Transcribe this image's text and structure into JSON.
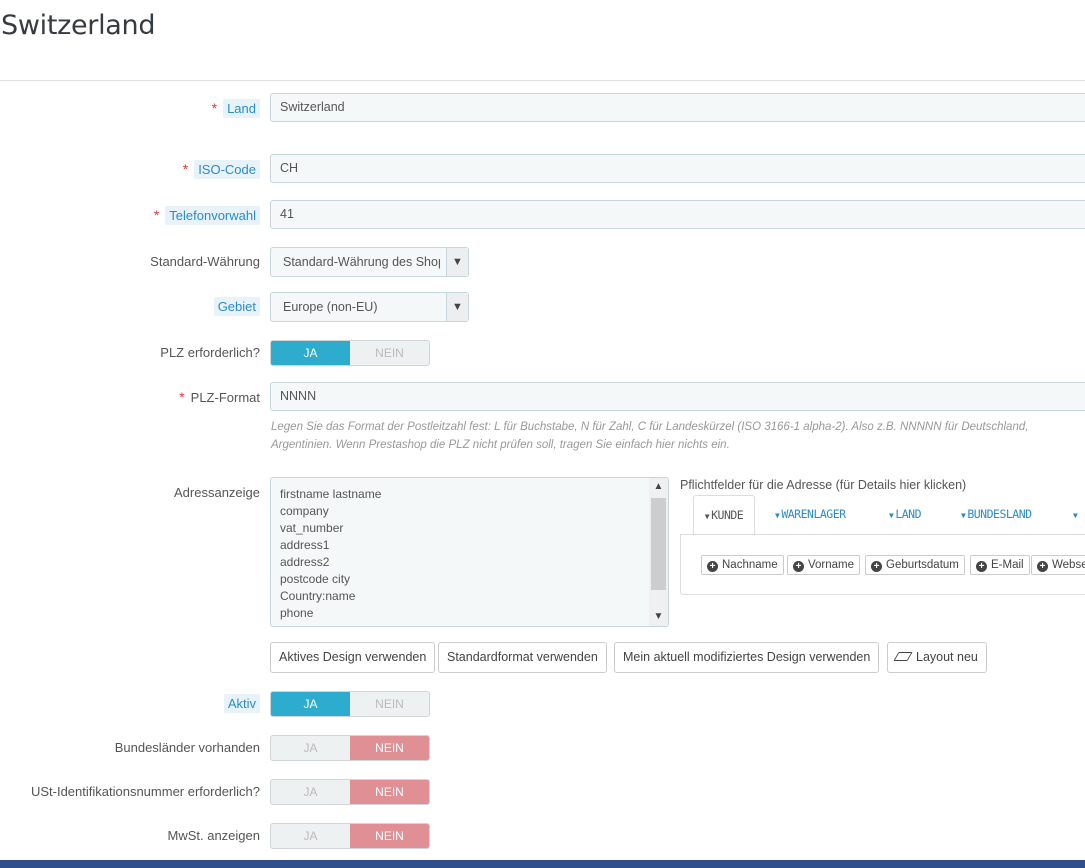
{
  "page": {
    "title": "Switzerland"
  },
  "form": {
    "land": {
      "label": "Land",
      "value": "Switzerland"
    },
    "iso": {
      "label": "ISO-Code",
      "value": "CH"
    },
    "phone": {
      "label": "Telefonvorwahl",
      "value": "41"
    },
    "currency": {
      "label": "Standard-Währung",
      "value": "Standard-Währung des Shop"
    },
    "zone": {
      "label": "Gebiet",
      "value": "Europe (non-EU)"
    },
    "zip_required": {
      "label": "PLZ erforderlich?",
      "yes": "JA",
      "no": "NEIN",
      "active": "yes"
    },
    "zip_format": {
      "label": "PLZ-Format",
      "value": "NNNN",
      "help_line1": "Legen Sie das Format der Postleitzahl fest: L für Buchstabe, N für Zahl, C für Landeskürzel (ISO 3166-1 alpha-2). Also z.B. NNNNN für Deutschland,",
      "help_line2": "Argentinien. Wenn Prestashop die PLZ nicht prüfen soll, tragen Sie einfach hier nichts ein."
    },
    "address_layout": {
      "label": "Adressanzeige",
      "lines": [
        "firstname lastname",
        "company",
        "vat_number",
        "address1",
        "address2",
        "postcode city",
        "Country:name",
        "phone"
      ]
    },
    "required_fields": {
      "title": "Pflichtfelder für die Adresse (für Details hier klicken)",
      "tabs": [
        "KUNDE",
        "WARENLAGER",
        "LAND",
        "BUNDESLAND"
      ],
      "buttons": [
        "Nachname",
        "Vorname",
        "Geburtsdatum",
        "E-Mail",
        "Webse"
      ]
    },
    "layout_buttons": {
      "active_design": "Aktives Design verwenden",
      "standard_format": "Standardformat verwenden",
      "modified_design": "Mein aktuell modifiziertes Design verwenden",
      "reset": "Layout neu"
    },
    "active": {
      "label": "Aktiv",
      "yes": "JA",
      "no": "NEIN",
      "active": "yes"
    },
    "states": {
      "label": "Bundesländer vorhanden",
      "yes": "JA",
      "no": "NEIN",
      "active": "no"
    },
    "vat_required": {
      "label": "USt-Identifikationsnummer erforderlich?",
      "yes": "JA",
      "no": "NEIN",
      "active": "no"
    },
    "show_tax": {
      "label": "MwSt. anzeigen",
      "yes": "JA",
      "no": "NEIN",
      "active": "no"
    }
  },
  "colors": {
    "accent": "#2eacce",
    "danger": "#e08f95",
    "required": "#e0373c",
    "footer": "#2e4e8c"
  }
}
